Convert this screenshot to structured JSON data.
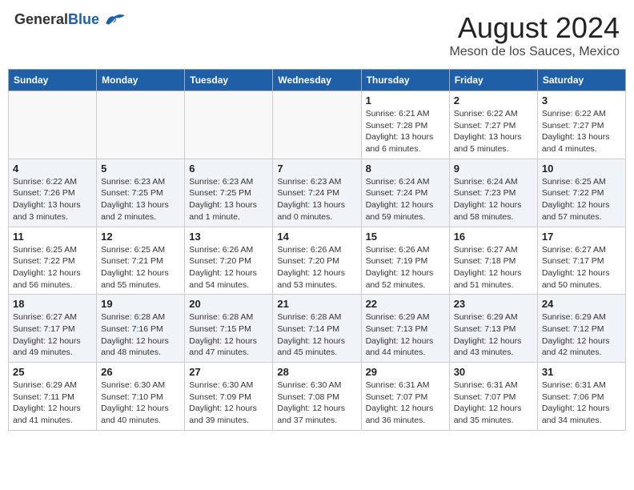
{
  "header": {
    "logo_general": "General",
    "logo_blue": "Blue",
    "month_year": "August 2024",
    "location": "Meson de los Sauces, Mexico"
  },
  "weekdays": [
    "Sunday",
    "Monday",
    "Tuesday",
    "Wednesday",
    "Thursday",
    "Friday",
    "Saturday"
  ],
  "weeks": [
    [
      {
        "day": "",
        "info": ""
      },
      {
        "day": "",
        "info": ""
      },
      {
        "day": "",
        "info": ""
      },
      {
        "day": "",
        "info": ""
      },
      {
        "day": "1",
        "info": "Sunrise: 6:21 AM\nSunset: 7:28 PM\nDaylight: 13 hours\nand 6 minutes."
      },
      {
        "day": "2",
        "info": "Sunrise: 6:22 AM\nSunset: 7:27 PM\nDaylight: 13 hours\nand 5 minutes."
      },
      {
        "day": "3",
        "info": "Sunrise: 6:22 AM\nSunset: 7:27 PM\nDaylight: 13 hours\nand 4 minutes."
      }
    ],
    [
      {
        "day": "4",
        "info": "Sunrise: 6:22 AM\nSunset: 7:26 PM\nDaylight: 13 hours\nand 3 minutes."
      },
      {
        "day": "5",
        "info": "Sunrise: 6:23 AM\nSunset: 7:25 PM\nDaylight: 13 hours\nand 2 minutes."
      },
      {
        "day": "6",
        "info": "Sunrise: 6:23 AM\nSunset: 7:25 PM\nDaylight: 13 hours\nand 1 minute."
      },
      {
        "day": "7",
        "info": "Sunrise: 6:23 AM\nSunset: 7:24 PM\nDaylight: 13 hours\nand 0 minutes."
      },
      {
        "day": "8",
        "info": "Sunrise: 6:24 AM\nSunset: 7:24 PM\nDaylight: 12 hours\nand 59 minutes."
      },
      {
        "day": "9",
        "info": "Sunrise: 6:24 AM\nSunset: 7:23 PM\nDaylight: 12 hours\nand 58 minutes."
      },
      {
        "day": "10",
        "info": "Sunrise: 6:25 AM\nSunset: 7:22 PM\nDaylight: 12 hours\nand 57 minutes."
      }
    ],
    [
      {
        "day": "11",
        "info": "Sunrise: 6:25 AM\nSunset: 7:22 PM\nDaylight: 12 hours\nand 56 minutes."
      },
      {
        "day": "12",
        "info": "Sunrise: 6:25 AM\nSunset: 7:21 PM\nDaylight: 12 hours\nand 55 minutes."
      },
      {
        "day": "13",
        "info": "Sunrise: 6:26 AM\nSunset: 7:20 PM\nDaylight: 12 hours\nand 54 minutes."
      },
      {
        "day": "14",
        "info": "Sunrise: 6:26 AM\nSunset: 7:20 PM\nDaylight: 12 hours\nand 53 minutes."
      },
      {
        "day": "15",
        "info": "Sunrise: 6:26 AM\nSunset: 7:19 PM\nDaylight: 12 hours\nand 52 minutes."
      },
      {
        "day": "16",
        "info": "Sunrise: 6:27 AM\nSunset: 7:18 PM\nDaylight: 12 hours\nand 51 minutes."
      },
      {
        "day": "17",
        "info": "Sunrise: 6:27 AM\nSunset: 7:17 PM\nDaylight: 12 hours\nand 50 minutes."
      }
    ],
    [
      {
        "day": "18",
        "info": "Sunrise: 6:27 AM\nSunset: 7:17 PM\nDaylight: 12 hours\nand 49 minutes."
      },
      {
        "day": "19",
        "info": "Sunrise: 6:28 AM\nSunset: 7:16 PM\nDaylight: 12 hours\nand 48 minutes."
      },
      {
        "day": "20",
        "info": "Sunrise: 6:28 AM\nSunset: 7:15 PM\nDaylight: 12 hours\nand 47 minutes."
      },
      {
        "day": "21",
        "info": "Sunrise: 6:28 AM\nSunset: 7:14 PM\nDaylight: 12 hours\nand 45 minutes."
      },
      {
        "day": "22",
        "info": "Sunrise: 6:29 AM\nSunset: 7:13 PM\nDaylight: 12 hours\nand 44 minutes."
      },
      {
        "day": "23",
        "info": "Sunrise: 6:29 AM\nSunset: 7:13 PM\nDaylight: 12 hours\nand 43 minutes."
      },
      {
        "day": "24",
        "info": "Sunrise: 6:29 AM\nSunset: 7:12 PM\nDaylight: 12 hours\nand 42 minutes."
      }
    ],
    [
      {
        "day": "25",
        "info": "Sunrise: 6:29 AM\nSunset: 7:11 PM\nDaylight: 12 hours\nand 41 minutes."
      },
      {
        "day": "26",
        "info": "Sunrise: 6:30 AM\nSunset: 7:10 PM\nDaylight: 12 hours\nand 40 minutes."
      },
      {
        "day": "27",
        "info": "Sunrise: 6:30 AM\nSunset: 7:09 PM\nDaylight: 12 hours\nand 39 minutes."
      },
      {
        "day": "28",
        "info": "Sunrise: 6:30 AM\nSunset: 7:08 PM\nDaylight: 12 hours\nand 37 minutes."
      },
      {
        "day": "29",
        "info": "Sunrise: 6:31 AM\nSunset: 7:07 PM\nDaylight: 12 hours\nand 36 minutes."
      },
      {
        "day": "30",
        "info": "Sunrise: 6:31 AM\nSunset: 7:07 PM\nDaylight: 12 hours\nand 35 minutes."
      },
      {
        "day": "31",
        "info": "Sunrise: 6:31 AM\nSunset: 7:06 PM\nDaylight: 12 hours\nand 34 minutes."
      }
    ]
  ]
}
